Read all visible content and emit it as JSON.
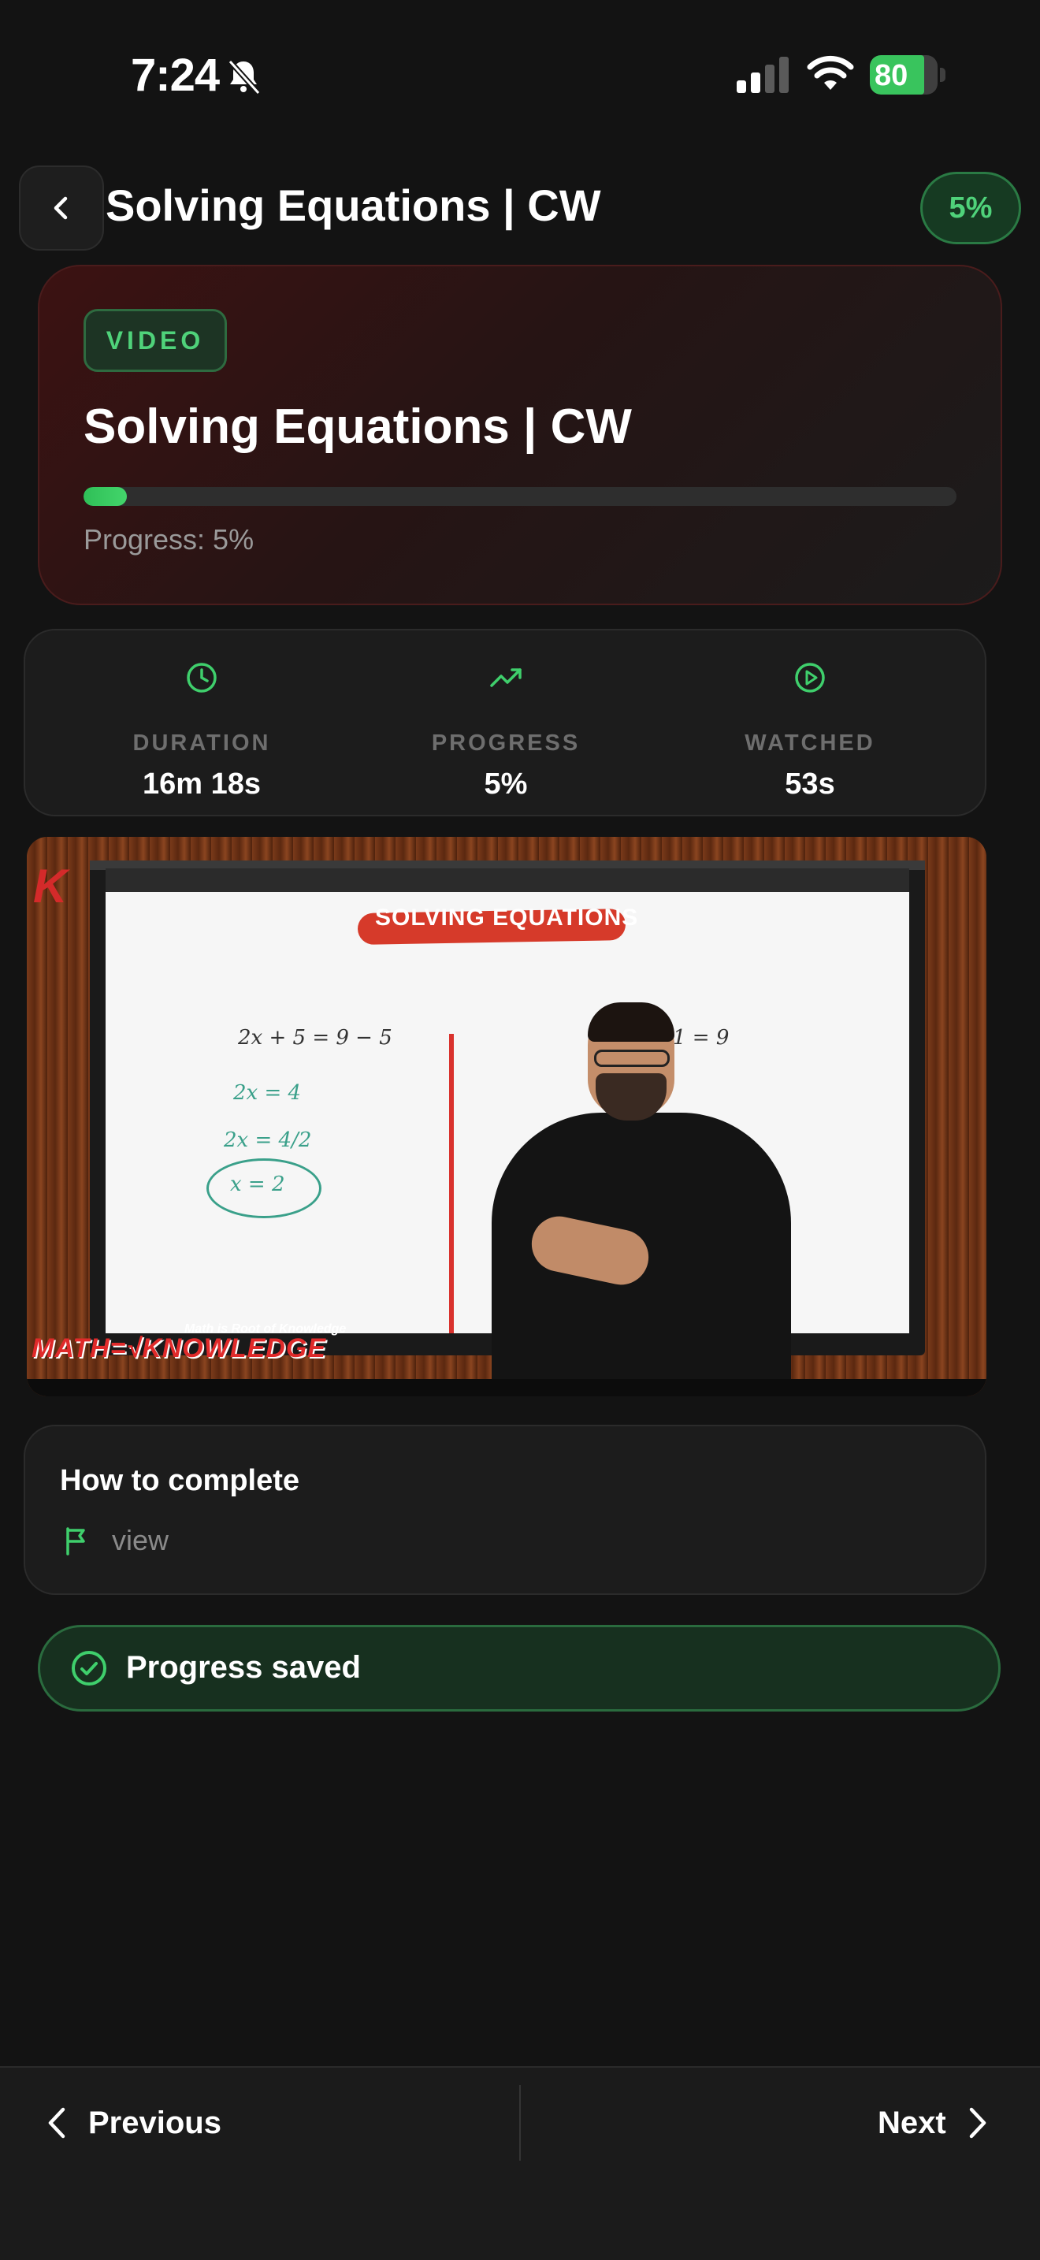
{
  "status_bar": {
    "time": "7:24",
    "battery": "80"
  },
  "header": {
    "title": "Solving Equations | CW",
    "progress_badge": "5%"
  },
  "hero": {
    "type_badge": "VIDEO",
    "title": "Solving Equations | CW",
    "progress_fraction": 0.05,
    "progress_text": "Progress: 5%"
  },
  "stats": [
    {
      "label": "DURATION",
      "value": "16m 18s",
      "icon": "clock-icon"
    },
    {
      "label": "PROGRESS",
      "value": "5%",
      "icon": "trending-up-icon"
    },
    {
      "label": "WATCHED",
      "value": "53s",
      "icon": "play-circle-icon"
    }
  ],
  "video": {
    "banner": "SOLVING EQUATIONS",
    "brand": "MATH=√KNOWLEDGE",
    "brand_sub": "Math is Root of Knowledge",
    "board": [
      "2x + 5 = 9 − 5",
      "2x = 4",
      "2x = 4/2",
      "x = 2",
      "1 = 9"
    ]
  },
  "how_to": {
    "title": "How to complete",
    "item": "view"
  },
  "saved": {
    "text": "Progress saved"
  },
  "nav": {
    "previous": "Previous",
    "next": "Next"
  },
  "colors": {
    "accent": "#4fd27a",
    "background": "#131313",
    "card": "#1c1c1c"
  }
}
